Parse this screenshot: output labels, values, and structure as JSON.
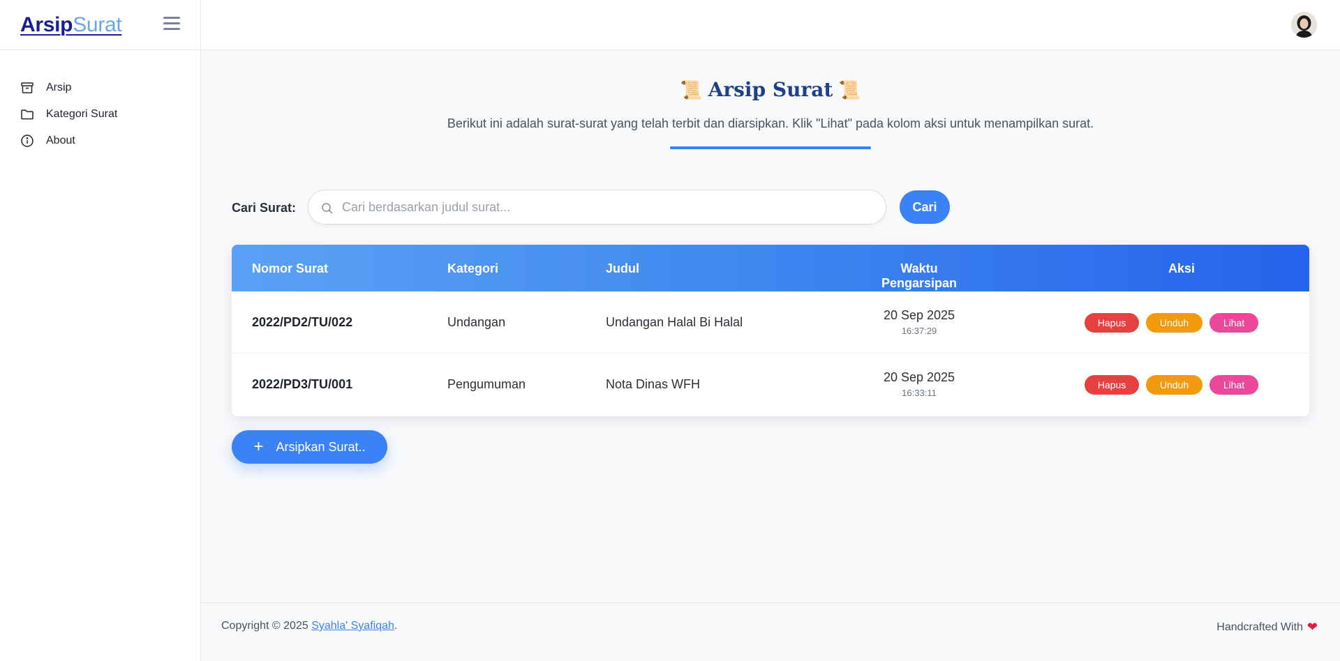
{
  "brand": {
    "strong": "Arsip",
    "light": "Surat"
  },
  "sidebar": {
    "items": [
      {
        "label": "Arsip",
        "icon": "archive-icon"
      },
      {
        "label": "Kategori Surat",
        "icon": "folder-icon"
      },
      {
        "label": "About",
        "icon": "info-icon"
      }
    ]
  },
  "header": {
    "title": "Arsip Surat",
    "scroll_icon": "📜",
    "subtitle": "Berikut ini adalah surat-surat yang telah terbit dan diarsipkan. Klik \"Lihat\" pada kolom aksi untuk menampilkan surat."
  },
  "search": {
    "label": "Cari Surat:",
    "placeholder": "Cari berdasarkan judul surat...",
    "value": "",
    "button": "Cari"
  },
  "table": {
    "columns": [
      "Nomor Surat",
      "Kategori",
      "Judul",
      "Waktu Pengarsipan",
      "Aksi"
    ],
    "rows": [
      {
        "nomor": "2022/PD2/TU/022",
        "kategori": "Undangan",
        "judul": "Undangan Halal Bi Halal",
        "tanggal": "20 Sep 2025",
        "jam": "16:37:29"
      },
      {
        "nomor": "2022/PD3/TU/001",
        "kategori": "Pengumuman",
        "judul": "Nota Dinas WFH",
        "tanggal": "20 Sep 2025",
        "jam": "16:33:11"
      }
    ],
    "actions": {
      "delete": "Hapus",
      "download": "Unduh",
      "view": "Lihat"
    }
  },
  "add_button": {
    "label": "Arsipkan Surat..",
    "icon": "+"
  },
  "footer": {
    "copyright_prefix": "Copyright © 2025 ",
    "author": "Syahla' Syafiqah",
    "copyright_suffix": ".",
    "credit": "Handcrafted With",
    "heart": "❤"
  },
  "colors": {
    "accent": "#3b82f6",
    "delete": "#e74040",
    "download": "#f29a0e",
    "view": "#ec4899",
    "title": "#1f3f86"
  }
}
